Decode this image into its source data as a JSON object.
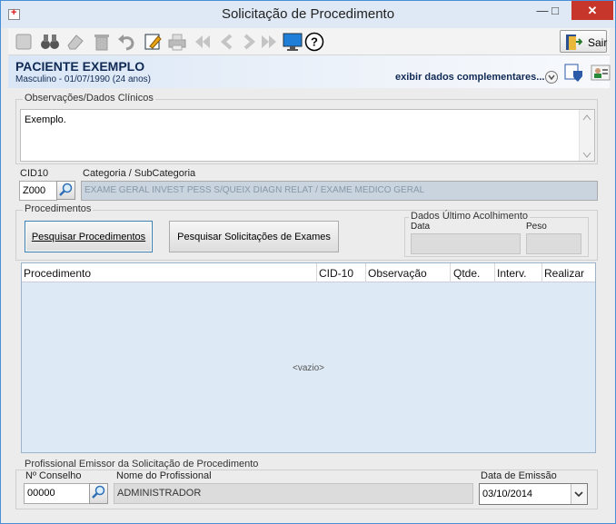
{
  "window": {
    "title": "Solicitação de Procedimento"
  },
  "toolbar": {
    "icons": [
      "new-icon",
      "binoculars-icon",
      "eraser-icon",
      "trash-icon",
      "undo-icon",
      "edit-icon",
      "print-icon",
      "first-icon",
      "prev-icon",
      "next-icon",
      "last-icon",
      "monitor-icon",
      "help-icon"
    ],
    "exit_label": "Sair"
  },
  "patient": {
    "name": "PACIENTE EXEMPLO",
    "info": "Masculino - 01/07/1990 (24 anos)",
    "extra_link": "exibir dados complementares..."
  },
  "observations": {
    "label": "Observações/Dados Clínicos",
    "text": "Exemplo."
  },
  "cid": {
    "label": "CID10",
    "value": "Z000",
    "category_label": "Categoria / SubCategoria",
    "category_value": "EXAME GERAL INVEST PESS S/QUEIX DIAGN RELAT / EXAME MEDICO GERAL"
  },
  "procedures": {
    "label": "Procedimentos",
    "search_button": "Pesquisar Procedimentos",
    "search_exams_button": "Pesquisar Solicitações de Exames"
  },
  "last_intake": {
    "label": "Dados Último Acolhimento",
    "date_label": "Data",
    "weight_label": "Peso"
  },
  "grid": {
    "columns": [
      "Procedimento",
      "CID-10",
      "Observação",
      "Qtde.",
      "Interv.",
      "Realizar"
    ],
    "empty_text": "<vazio>"
  },
  "professional": {
    "label": "Profissional Emissor da Solicitação de Procedimento",
    "council_label": "Nº Conselho",
    "council_value": "00000",
    "name_label": "Nome do Profissional",
    "name_value": "ADMINISTRADOR",
    "date_label": "Data de Emissão",
    "date_value": "03/10/2014"
  },
  "colors": {
    "title_bar": "#dfe9f5",
    "close_button": "#c7362b",
    "header_text": "#102a55",
    "grid_body": "#dde9f5"
  }
}
